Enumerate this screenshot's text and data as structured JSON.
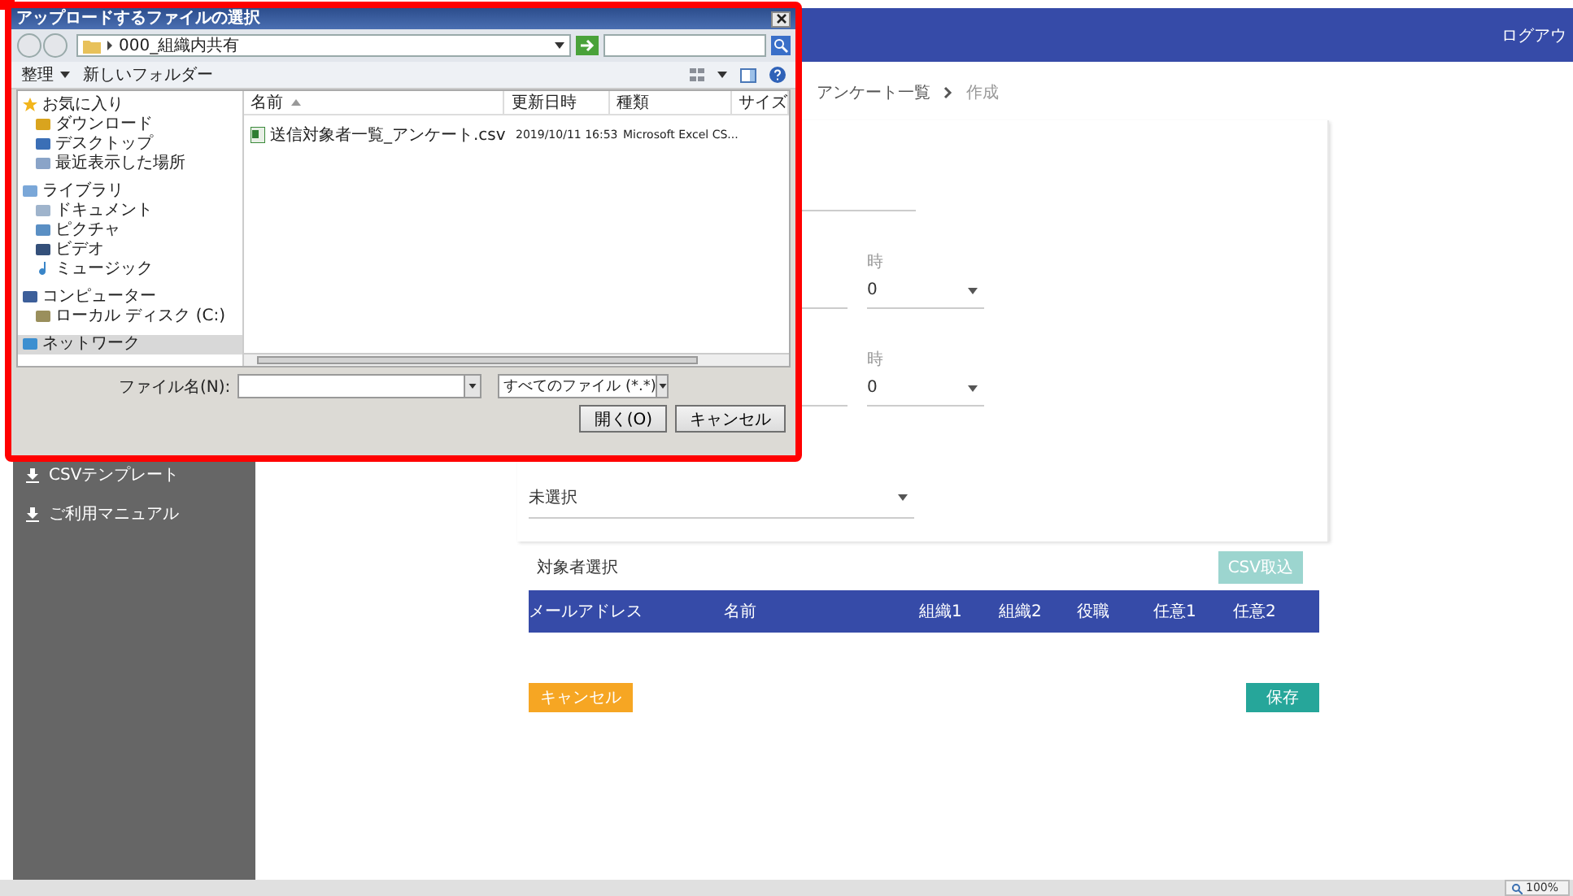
{
  "header": {
    "logout": "ログアウ"
  },
  "sidebar": {
    "items": [
      {
        "label": "CSVテンプレート"
      },
      {
        "label": "ご利用マニュアル"
      }
    ]
  },
  "breadcrumb": [
    "アンケート一覧",
    "作成"
  ],
  "form": {
    "date_rows": [
      {
        "hour_label": "時",
        "hour_value": "0"
      },
      {
        "hour_label": "時",
        "hour_value": "0"
      }
    ],
    "select_value": "未選択"
  },
  "targets": {
    "title": "対象者選択",
    "csv_button": {
      "label": "CSV取込",
      "disabled": true
    },
    "columns": [
      "メールアドレス",
      "名前",
      "組織1",
      "組織2",
      "役職",
      "任意1",
      "任意2"
    ]
  },
  "actions": {
    "cancel": "キャンセル",
    "save": "保存"
  },
  "status_bar": {
    "zoom": "100%"
  },
  "dialog": {
    "title": "アップロードするファイルの選択",
    "path": "000_組織内共有",
    "toolbar": [
      "整理",
      "新しいフォルダー"
    ],
    "nav": [
      {
        "label": "お気に入り",
        "selected": false,
        "children": [
          {
            "label": "ダウンロード",
            "selected": false
          },
          {
            "label": "デスクトップ",
            "selected": false
          },
          {
            "label": "最近表示した場所",
            "selected": false
          }
        ]
      },
      {
        "label": "ライブラリ",
        "selected": false,
        "children": [
          {
            "label": "ドキュメント",
            "selected": false
          },
          {
            "label": "ピクチャ",
            "selected": false
          },
          {
            "label": "ビデオ",
            "selected": false
          },
          {
            "label": "ミュージック",
            "selected": false
          }
        ]
      },
      {
        "label": "コンピューター",
        "selected": false,
        "children": [
          {
            "label": "ローカル ディスク (C:)",
            "selected": false
          }
        ]
      },
      {
        "label": "ネットワーク",
        "selected": true
      }
    ],
    "columns": [
      "名前",
      "更新日時",
      "種類",
      "サイズ"
    ],
    "files": [
      {
        "name": "送信対象者一覧_アンケート.csv",
        "modified": "2019/10/11 16:53",
        "type": "Microsoft Excel CS..."
      }
    ],
    "filename_label": "ファイル名(N):",
    "filter": "すべてのファイル (*.*)",
    "buttons": [
      "開く(O)",
      "キャンセル"
    ]
  }
}
